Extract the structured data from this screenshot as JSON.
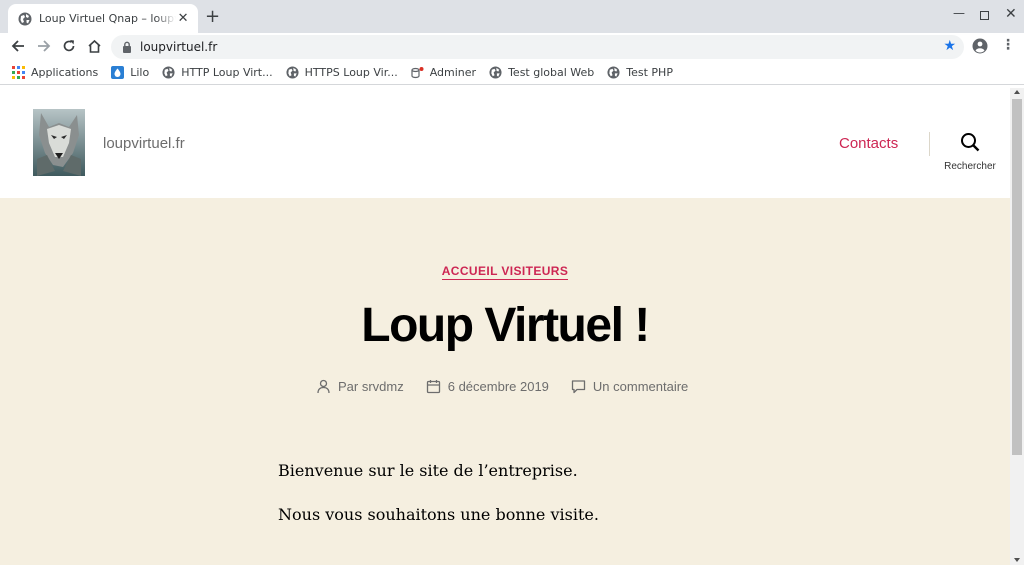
{
  "browser": {
    "tab_title": "Loup Virtuel Qnap – loupvirtuel.fr",
    "tab_close": "✕",
    "new_tab": "+",
    "url": "loupvirtuel.fr",
    "bookmark_star_color": "#1a73e8",
    "bookmarks": [
      {
        "label": "Applications",
        "icon": "apps-grid-icon"
      },
      {
        "label": "Lilo",
        "icon": "lilo-icon"
      },
      {
        "label": "HTTP Loup Virt...",
        "icon": "globe-icon"
      },
      {
        "label": "HTTPS Loup Vir...",
        "icon": "globe-icon"
      },
      {
        "label": "Adminer",
        "icon": "adminer-icon"
      },
      {
        "label": "Test global Web",
        "icon": "globe-icon"
      },
      {
        "label": "Test PHP",
        "icon": "globe-icon"
      }
    ]
  },
  "site": {
    "name": "loupvirtuel.fr",
    "nav_contacts": "Contacts",
    "search_label": "Rechercher",
    "accent_color": "#cd2653",
    "hero_background": "#f5efe0"
  },
  "post": {
    "category": "ACCUEIL VISITEURS",
    "title": "Loup Virtuel !",
    "author": "Par srvdmz",
    "date": "6 décembre 2019",
    "comments": "Un commentaire",
    "paragraphs": [
      "Bienvenue sur le site de l’entreprise.",
      "Nous vous souhaitons une bonne visite."
    ]
  }
}
